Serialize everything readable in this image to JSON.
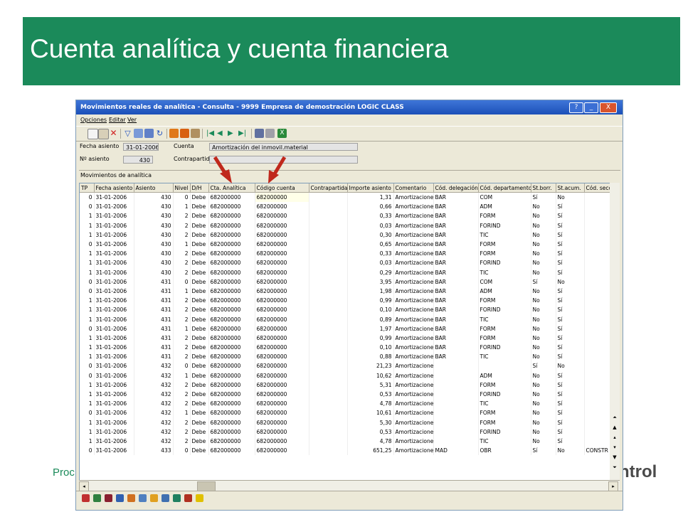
{
  "slide": {
    "title": "Cuenta analítica y cuenta financiera",
    "footer_left": "Proc",
    "footer_right": "ntrol"
  },
  "window": {
    "title": "Movimientos reales de analítica - Consulta - 9999 Empresa de demostración LOGIC CLASS",
    "help_label": "?",
    "min_label": "_",
    "max_label": "□",
    "close_label": "X"
  },
  "menu": [
    "Opciones",
    "Editar",
    "Ver"
  ],
  "form": {
    "fecha_label": "Fecha asiento",
    "fecha_value": "31-01-2006",
    "cuenta_label": "Cuenta",
    "cuenta_value": "Amortización del inmovil.material",
    "asiento_label": "Nº asiento",
    "asiento_value": "430",
    "contrapartida_label": "Contrapartida",
    "contrapartida_value": ""
  },
  "section_title": "Movimientos de analítica",
  "grid": {
    "columns": [
      "TP",
      "Fecha asiento",
      "Asiento",
      "Nivel",
      "D/H",
      "Cta. Analítica",
      "Código cuenta",
      "Contrapartida",
      "Importe asiento",
      "Comentario",
      "Cód. delegación",
      "Cód. departamento",
      "St.borr.",
      "St.acum.",
      "Cód. secc"
    ],
    "rows": [
      [
        "0",
        "31-01-2006",
        "430",
        "0",
        "Debe",
        "682000000",
        "682000000",
        "",
        "1,31",
        "Amortizaciones",
        "BAR",
        "COM",
        "Sí",
        "No",
        ""
      ],
      [
        "0",
        "31-01-2006",
        "430",
        "1",
        "Debe",
        "682000000",
        "682000000",
        "",
        "0,66",
        "Amortizaciones",
        "BAR",
        "ADM",
        "No",
        "Sí",
        ""
      ],
      [
        "1",
        "31-01-2006",
        "430",
        "2",
        "Debe",
        "682000000",
        "682000000",
        "",
        "0,33",
        "Amortizaciones",
        "BAR",
        "FORM",
        "No",
        "Sí",
        ""
      ],
      [
        "1",
        "31-01-2006",
        "430",
        "2",
        "Debe",
        "682000000",
        "682000000",
        "",
        "0,03",
        "Amortizaciones",
        "BAR",
        "FORIND",
        "No",
        "Sí",
        ""
      ],
      [
        "1",
        "31-01-2006",
        "430",
        "2",
        "Debe",
        "682000000",
        "682000000",
        "",
        "0,30",
        "Amortizaciones",
        "BAR",
        "TIC",
        "No",
        "Sí",
        ""
      ],
      [
        "0",
        "31-01-2006",
        "430",
        "1",
        "Debe",
        "682000000",
        "682000000",
        "",
        "0,65",
        "Amortizaciones",
        "BAR",
        "FORM",
        "No",
        "Sí",
        ""
      ],
      [
        "1",
        "31-01-2006",
        "430",
        "2",
        "Debe",
        "682000000",
        "682000000",
        "",
        "0,33",
        "Amortizaciones",
        "BAR",
        "FORM",
        "No",
        "Sí",
        ""
      ],
      [
        "1",
        "31-01-2006",
        "430",
        "2",
        "Debe",
        "682000000",
        "682000000",
        "",
        "0,03",
        "Amortizaciones",
        "BAR",
        "FORIND",
        "No",
        "Sí",
        ""
      ],
      [
        "1",
        "31-01-2006",
        "430",
        "2",
        "Debe",
        "682000000",
        "682000000",
        "",
        "0,29",
        "Amortizaciones",
        "BAR",
        "TIC",
        "No",
        "Sí",
        ""
      ],
      [
        "0",
        "31-01-2006",
        "431",
        "0",
        "Debe",
        "682000000",
        "682000000",
        "",
        "3,95",
        "Amortizaciones",
        "BAR",
        "COM",
        "Sí",
        "No",
        ""
      ],
      [
        "0",
        "31-01-2006",
        "431",
        "1",
        "Debe",
        "682000000",
        "682000000",
        "",
        "1,98",
        "Amortizaciones",
        "BAR",
        "ADM",
        "No",
        "Sí",
        ""
      ],
      [
        "1",
        "31-01-2006",
        "431",
        "2",
        "Debe",
        "682000000",
        "682000000",
        "",
        "0,99",
        "Amortizaciones",
        "BAR",
        "FORM",
        "No",
        "Sí",
        ""
      ],
      [
        "1",
        "31-01-2006",
        "431",
        "2",
        "Debe",
        "682000000",
        "682000000",
        "",
        "0,10",
        "Amortizaciones",
        "BAR",
        "FORIND",
        "No",
        "Sí",
        ""
      ],
      [
        "1",
        "31-01-2006",
        "431",
        "2",
        "Debe",
        "682000000",
        "682000000",
        "",
        "0,89",
        "Amortizaciones",
        "BAR",
        "TIC",
        "No",
        "Sí",
        ""
      ],
      [
        "0",
        "31-01-2006",
        "431",
        "1",
        "Debe",
        "682000000",
        "682000000",
        "",
        "1,97",
        "Amortizaciones",
        "BAR",
        "FORM",
        "No",
        "Sí",
        ""
      ],
      [
        "1",
        "31-01-2006",
        "431",
        "2",
        "Debe",
        "682000000",
        "682000000",
        "",
        "0,99",
        "Amortizaciones",
        "BAR",
        "FORM",
        "No",
        "Sí",
        ""
      ],
      [
        "1",
        "31-01-2006",
        "431",
        "2",
        "Debe",
        "682000000",
        "682000000",
        "",
        "0,10",
        "Amortizaciones",
        "BAR",
        "FORIND",
        "No",
        "Sí",
        ""
      ],
      [
        "1",
        "31-01-2006",
        "431",
        "2",
        "Debe",
        "682000000",
        "682000000",
        "",
        "0,88",
        "Amortizaciones",
        "BAR",
        "TIC",
        "No",
        "Sí",
        ""
      ],
      [
        "0",
        "31-01-2006",
        "432",
        "0",
        "Debe",
        "682000000",
        "682000000",
        "",
        "21,23",
        "Amortizaciones",
        "",
        "",
        "Sí",
        "No",
        ""
      ],
      [
        "0",
        "31-01-2006",
        "432",
        "1",
        "Debe",
        "682000000",
        "682000000",
        "",
        "10,62",
        "Amortizaciones",
        "",
        "ADM",
        "No",
        "Sí",
        ""
      ],
      [
        "1",
        "31-01-2006",
        "432",
        "2",
        "Debe",
        "682000000",
        "682000000",
        "",
        "5,31",
        "Amortizaciones",
        "",
        "FORM",
        "No",
        "Sí",
        ""
      ],
      [
        "1",
        "31-01-2006",
        "432",
        "2",
        "Debe",
        "682000000",
        "682000000",
        "",
        "0,53",
        "Amortizaciones",
        "",
        "FORIND",
        "No",
        "Sí",
        ""
      ],
      [
        "1",
        "31-01-2006",
        "432",
        "2",
        "Debe",
        "682000000",
        "682000000",
        "",
        "4,78",
        "Amortizaciones",
        "",
        "TIC",
        "No",
        "Sí",
        ""
      ],
      [
        "0",
        "31-01-2006",
        "432",
        "1",
        "Debe",
        "682000000",
        "682000000",
        "",
        "10,61",
        "Amortizaciones",
        "",
        "FORM",
        "No",
        "Sí",
        ""
      ],
      [
        "1",
        "31-01-2006",
        "432",
        "2",
        "Debe",
        "682000000",
        "682000000",
        "",
        "5,30",
        "Amortizaciones",
        "",
        "FORM",
        "No",
        "Sí",
        ""
      ],
      [
        "1",
        "31-01-2006",
        "432",
        "2",
        "Debe",
        "682000000",
        "682000000",
        "",
        "0,53",
        "Amortizaciones",
        "",
        "FORIND",
        "No",
        "Sí",
        ""
      ],
      [
        "1",
        "31-01-2006",
        "432",
        "2",
        "Debe",
        "682000000",
        "682000000",
        "",
        "4,78",
        "Amortizaciones",
        "",
        "TIC",
        "No",
        "Sí",
        ""
      ],
      [
        "0",
        "31-01-2006",
        "433",
        "0",
        "Debe",
        "682000000",
        "682000000",
        "",
        "651,25",
        "Amortizaciones",
        "MAD",
        "OBR",
        "Sí",
        "No",
        "CONSTR"
      ]
    ]
  },
  "colors": {
    "banner": "#1b8a5a",
    "titlebar": "#1f55c0",
    "arrow": "#c0281c",
    "window_bg": "#ece9d8"
  }
}
